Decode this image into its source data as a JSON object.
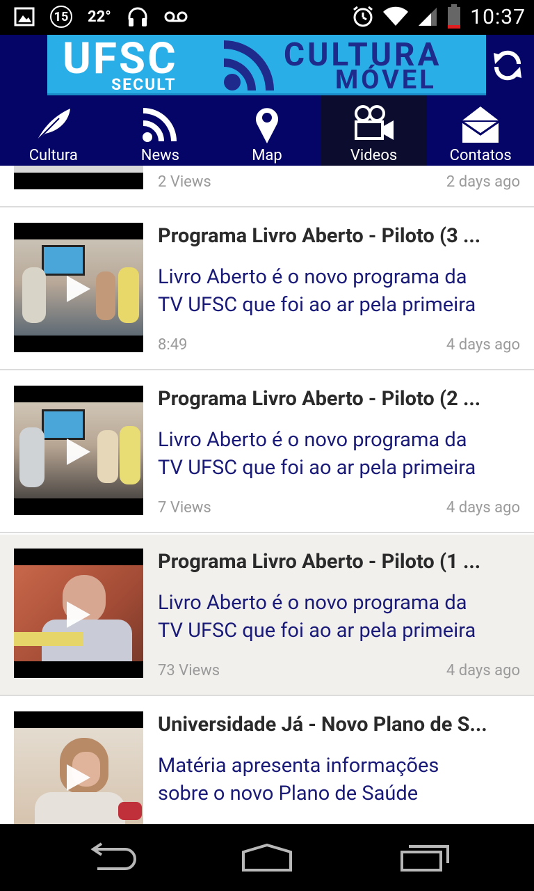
{
  "status_bar": {
    "notification_count": "15",
    "temperature": "22°",
    "time": "10:37"
  },
  "banner": {
    "logo_main": "UFSC",
    "logo_sub": "SECULT",
    "logo_title_1": "CULTURA",
    "logo_title_2": "MÓVEL"
  },
  "tabs": [
    {
      "label": "Cultura",
      "icon": "feather-icon"
    },
    {
      "label": "News",
      "icon": "rss-icon"
    },
    {
      "label": "Map",
      "icon": "map-pin-icon"
    },
    {
      "label": "Videos",
      "icon": "video-camera-icon",
      "active": true
    },
    {
      "label": "Contatos",
      "icon": "envelope-icon"
    }
  ],
  "videos": [
    {
      "views": "2 Views",
      "date": "2 days ago"
    },
    {
      "title": "Programa Livro Aberto - Piloto (3 ...",
      "desc_1": "Livro Aberto é o novo programa da",
      "desc_2": "TV UFSC que foi ao ar pela primeira",
      "views": "8:49",
      "date": "4 days ago"
    },
    {
      "title": "Programa Livro Aberto - Piloto (2 ...",
      "desc_1": "Livro Aberto é o novo programa da",
      "desc_2": "TV UFSC que foi ao ar pela primeira",
      "views": "7 Views",
      "date": "4 days ago"
    },
    {
      "title": "Programa Livro Aberto - Piloto (1 ...",
      "desc_1": "Livro Aberto é o novo programa da",
      "desc_2": "TV UFSC que foi ao ar pela primeira",
      "views": "73 Views",
      "date": "4 days ago",
      "selected": true
    },
    {
      "title": "Universidade Já - Novo Plano de S...",
      "desc_1": "Matéria apresenta informações",
      "desc_2": "sobre o novo Plano de Saúde",
      "views": "",
      "date": ""
    }
  ],
  "colors": {
    "header_bg": "#050567",
    "logo_bg": "#29aee8",
    "desc_text": "#1a1a78",
    "selected_row": "#f1f0ed"
  }
}
